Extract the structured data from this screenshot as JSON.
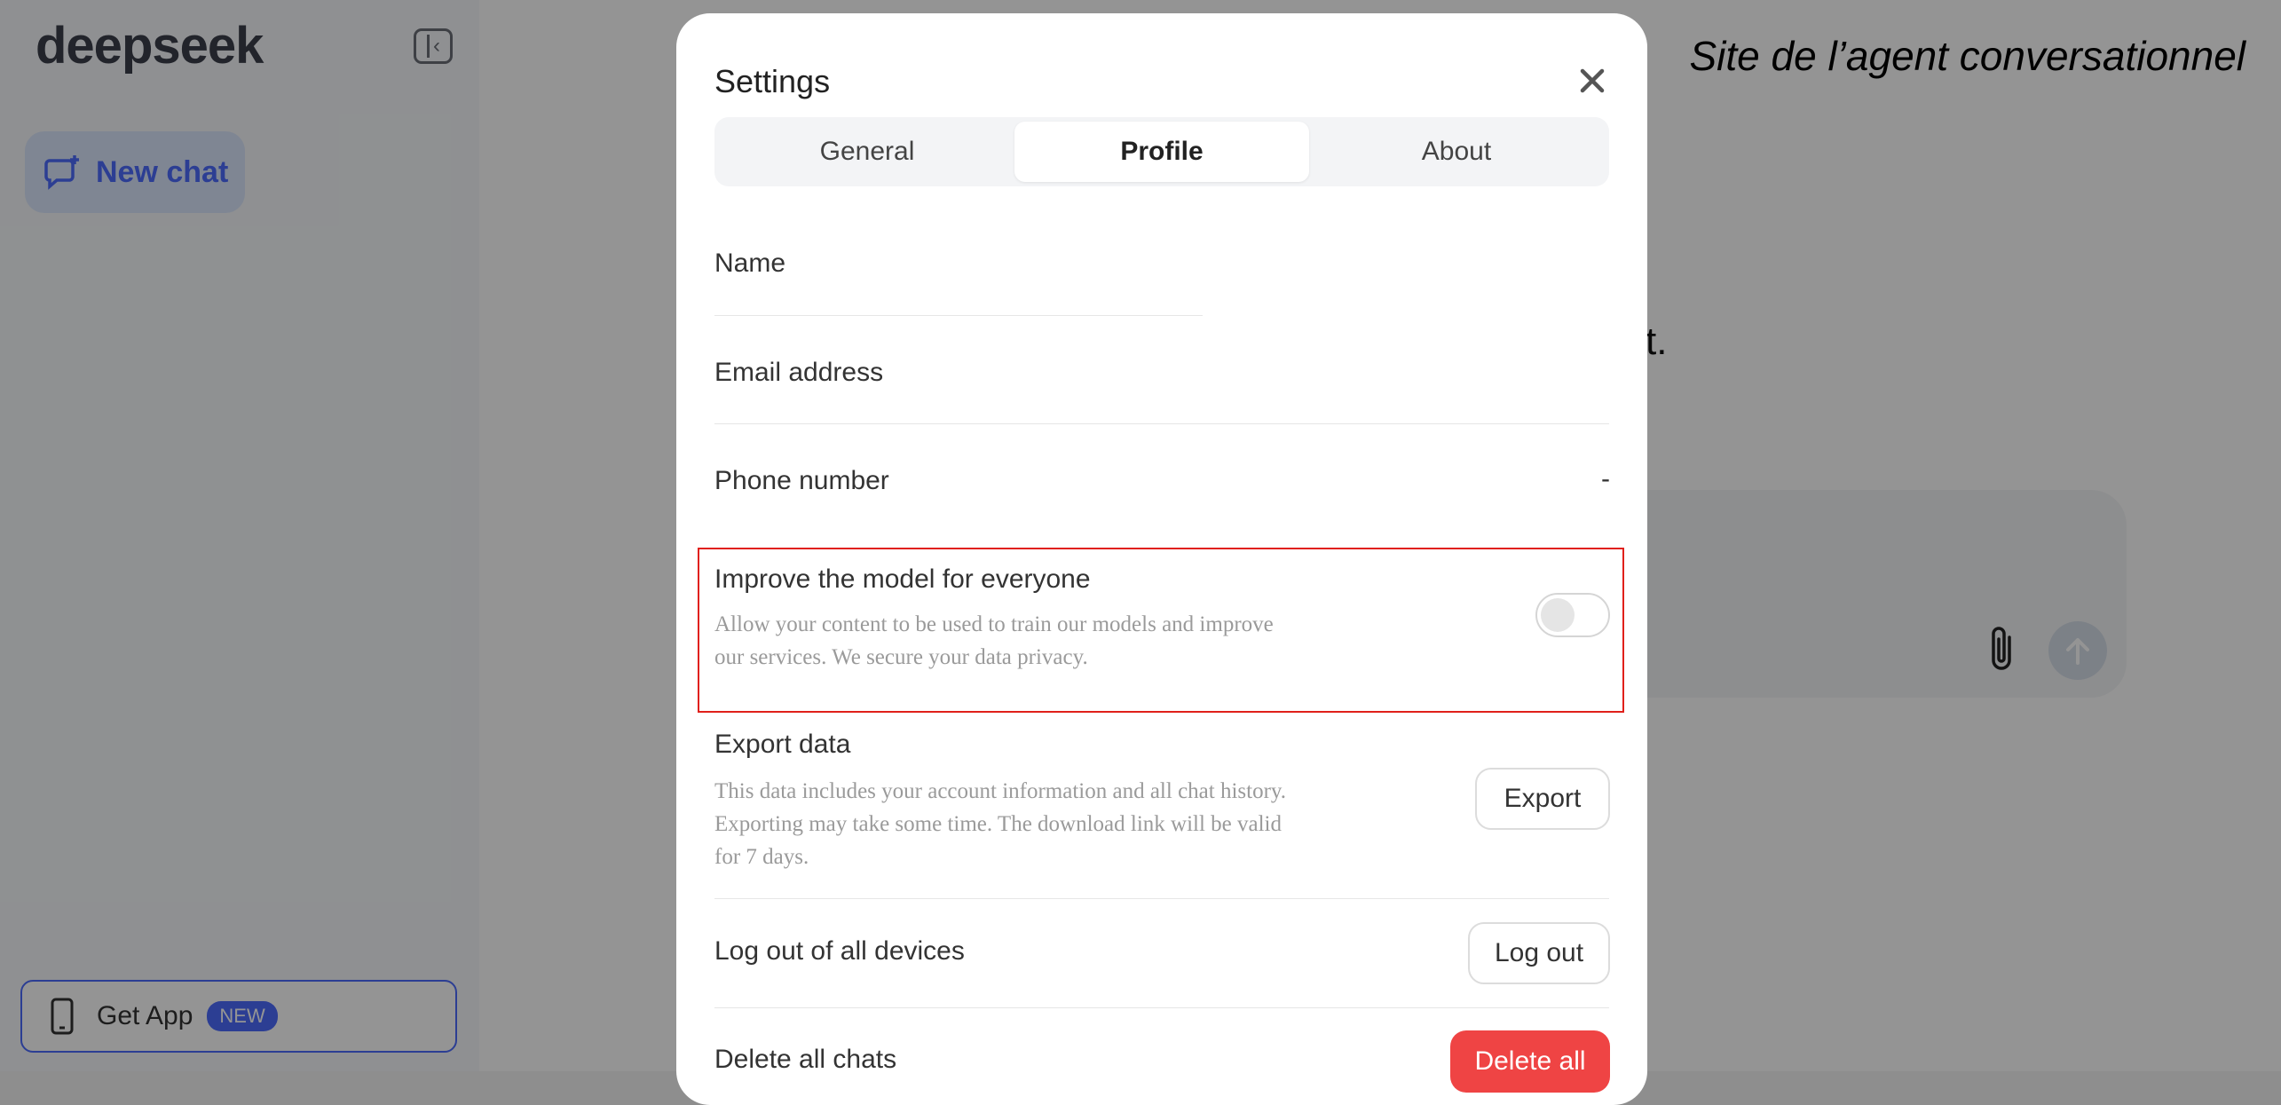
{
  "sidebar": {
    "logo": "deepseek",
    "new_chat_label": "New chat",
    "get_app_label": "Get App",
    "get_app_badge": "NEW"
  },
  "main": {
    "partial_text": "t."
  },
  "caption": "Site de l’agent conversationnel",
  "settings": {
    "title": "Settings",
    "tabs": [
      {
        "label": "General",
        "active": false
      },
      {
        "label": "Profile",
        "active": true
      },
      {
        "label": "About",
        "active": false
      }
    ],
    "name_label": "Name",
    "email_label": "Email address",
    "phone_label": "Phone number",
    "phone_value": "-",
    "improve": {
      "label": "Improve the model for everyone",
      "desc_line1": "Allow your content to be used to train our models and improve",
      "desc_line2": "our services. We secure your data privacy.",
      "enabled": false
    },
    "export": {
      "label": "Export data",
      "desc_line1": "This data includes your account information and all chat history.",
      "desc_line2": "Exporting may take some time. The download link will be valid",
      "desc_line3": "for 7 days.",
      "button": "Export"
    },
    "logout": {
      "label": "Log out of all devices",
      "button": "Log out"
    },
    "delete": {
      "label": "Delete all chats",
      "button": "Delete all"
    }
  },
  "colors": {
    "accent": "#4d6bfe",
    "danger": "#ef4444",
    "highlight": "#e0201b"
  }
}
